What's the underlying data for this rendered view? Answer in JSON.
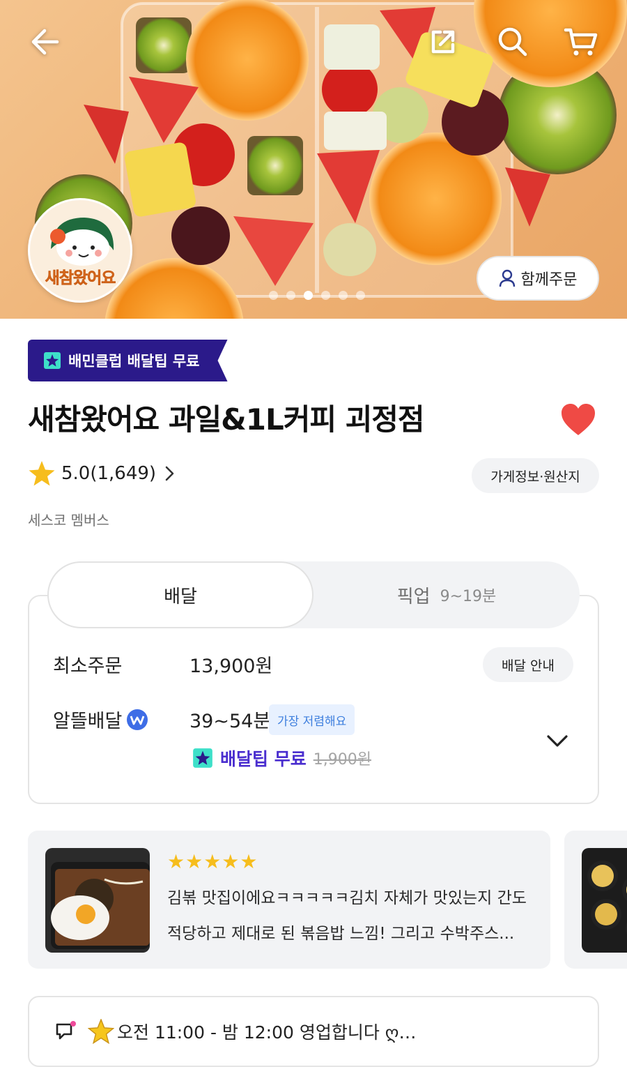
{
  "hero": {
    "logo_text": "새참왔어요",
    "together_order_label": "함께주문",
    "carousel_total": 6,
    "carousel_active": 3,
    "icons": [
      "back-arrow-icon",
      "share-icon",
      "search-icon",
      "cart-icon"
    ]
  },
  "store": {
    "club_badge": "배민클럽 배달팁 무료",
    "name": "새참왔어요 과일&1L커피 괴정점",
    "favorited": true,
    "rating": "5.0",
    "review_count": "(1,649)",
    "info_chip": "가게정보·원산지",
    "membership": "세스코 멤버스"
  },
  "delivery": {
    "tab_delivery": "배달",
    "tab_pickup": "픽업",
    "pickup_time": "9~19분",
    "min_order_label": "최소주문",
    "min_order_value": "13,900원",
    "guide_chip": "배달 안내",
    "saver_label": "알뜰배달",
    "saver_time": "39~54분",
    "cheapest_tag": "가장 저렴해요",
    "tip_free": "배달팁 무료",
    "tip_original": "1,900원"
  },
  "review": {
    "stars": "★★★★★",
    "line1": "김볶 맛집이에요ㅋㅋㅋㅋㅋ김치 자체가 맛있는지 간도",
    "line2": "적당하고 제대로 된 볶음밥 느낌! 그리고 수박주스..."
  },
  "notice": {
    "text": "오전 11:00 - 밤 12:00 영업합니다 ღ…"
  },
  "colors": {
    "club_purple": "#2b1a8a",
    "tip_purple": "#4a2ecf",
    "heart_red": "#ef4a45",
    "star_yellow": "#f6bd1d",
    "tag_blue": "#3e7fde"
  }
}
